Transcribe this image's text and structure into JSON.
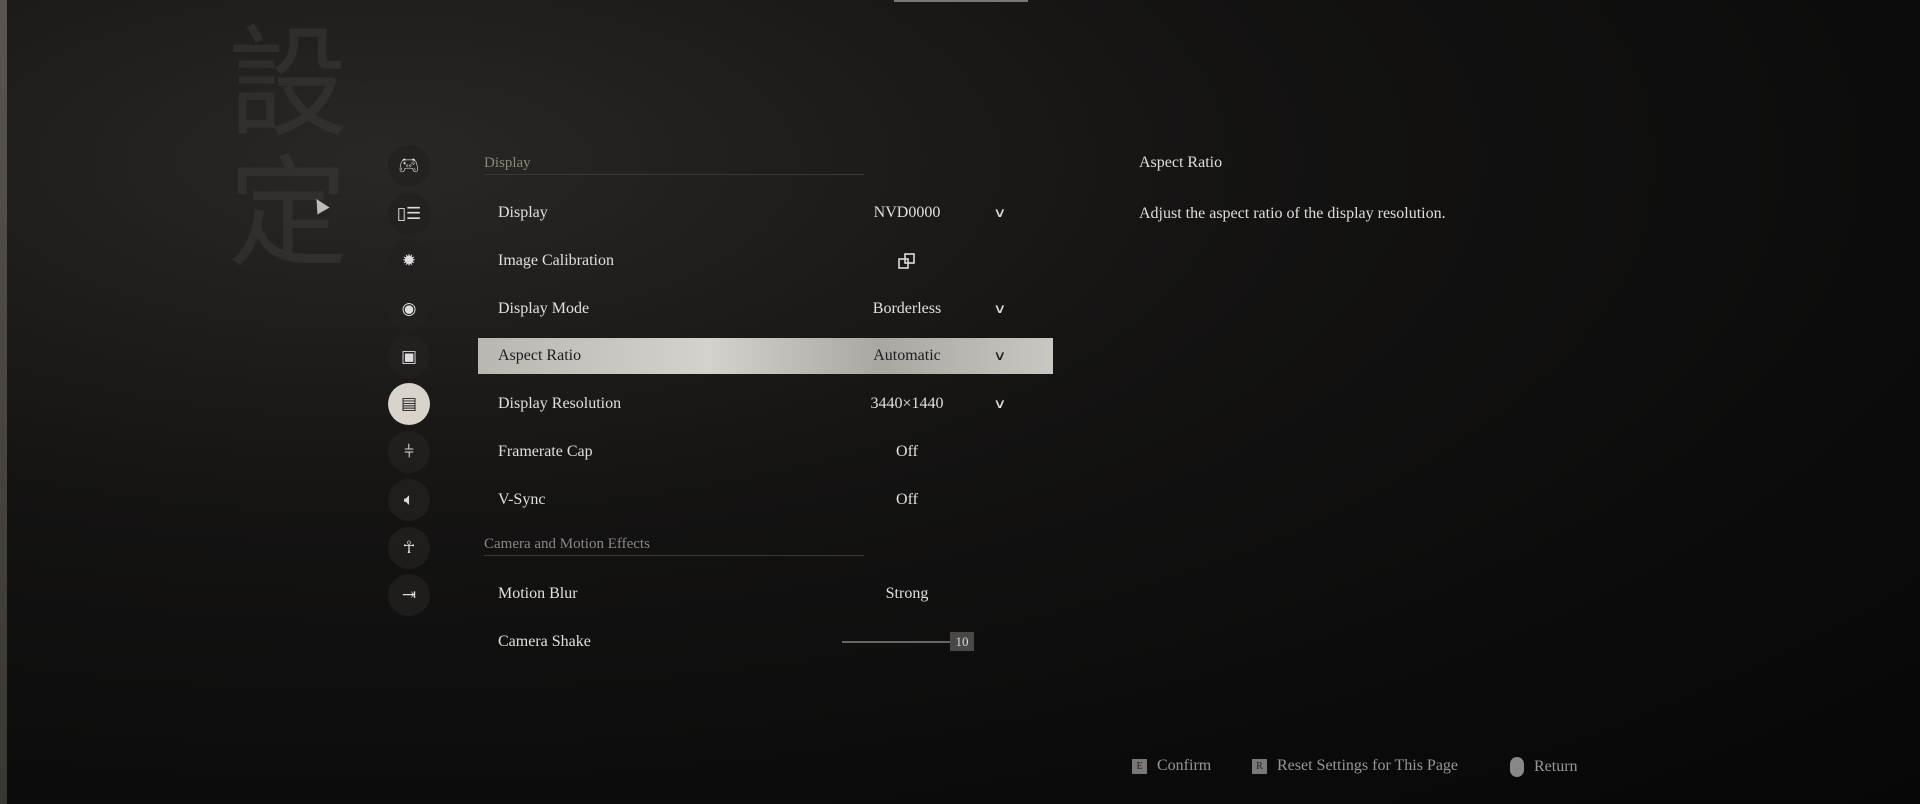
{
  "background_calligraphy": "設定",
  "nav": {
    "items": [
      {
        "icon": "gamepad-icon",
        "name": "controls"
      },
      {
        "icon": "mouse-keyboard-icon",
        "name": "keyboard-mouse"
      },
      {
        "icon": "brightness-icon",
        "name": "brightness"
      },
      {
        "icon": "eye-icon",
        "name": "visibility"
      },
      {
        "icon": "subtitles-icon",
        "name": "subtitles"
      },
      {
        "icon": "monitor-icon",
        "name": "display",
        "active": true
      },
      {
        "icon": "sliders-icon",
        "name": "graphics"
      },
      {
        "icon": "speaker-icon",
        "name": "audio"
      },
      {
        "icon": "accessibility-icon",
        "name": "accessibility"
      },
      {
        "icon": "exit-icon",
        "name": "exit"
      }
    ]
  },
  "sections": [
    {
      "title": "Display",
      "rows": [
        {
          "label": "Display",
          "value": "NVD0000",
          "dropdown": true
        },
        {
          "label": "Image Calibration",
          "value": "",
          "icon": "open-external-icon"
        },
        {
          "label": "Display Mode",
          "value": "Borderless",
          "dropdown": true
        },
        {
          "label": "Aspect Ratio",
          "value": "Automatic",
          "dropdown": true,
          "selected": true
        },
        {
          "label": "Display Resolution",
          "value": "3440×1440",
          "dropdown": true
        },
        {
          "label": "Framerate Cap",
          "value": "Off"
        },
        {
          "label": "V-Sync",
          "value": "Off"
        }
      ]
    },
    {
      "title": "Camera and Motion Effects",
      "rows": [
        {
          "label": "Motion Blur",
          "value": "Strong"
        },
        {
          "label": "Camera Shake",
          "value": "10",
          "slider_percent": 100
        }
      ]
    }
  ],
  "detail": {
    "title": "Aspect Ratio",
    "description": "Adjust the aspect ratio of the display resolution."
  },
  "footer": {
    "confirm_key": "E",
    "confirm": "Confirm",
    "reset_key": "R",
    "reset": "Reset Settings for This Page",
    "return": "Return"
  },
  "colors": {
    "highlight": "#c8c6c0",
    "background": "#0b0b0b"
  }
}
